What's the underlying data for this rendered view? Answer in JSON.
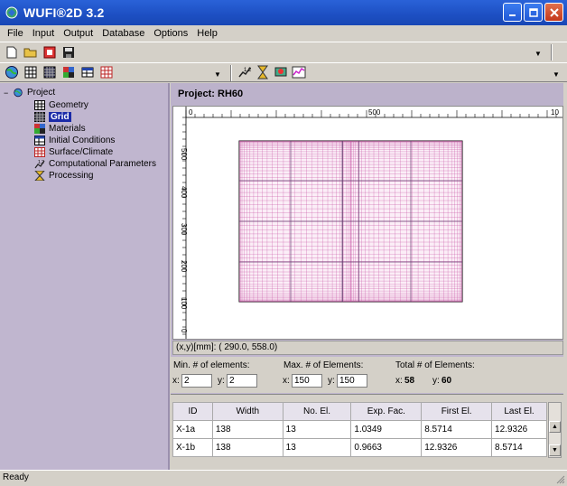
{
  "window": {
    "title": "WUFI®2D 3.2"
  },
  "menu": [
    "File",
    "Input",
    "Output",
    "Database",
    "Options",
    "Help"
  ],
  "toolbar1": {
    "icons": [
      "new-file-icon",
      "open-folder-icon",
      "export-icon",
      "save-icon"
    ]
  },
  "toolbar2": {
    "icons": [
      "globe-icon",
      "grid-icon",
      "grid-dark-icon",
      "grid-colored-icon",
      "table-icon",
      "grid-red-icon",
      "run-icon",
      "hourglass-icon",
      "results-icon",
      "chart-icon"
    ]
  },
  "tree": {
    "root": "Project",
    "items": [
      {
        "label": "Geometry",
        "icon": "geometry-icon"
      },
      {
        "label": "Grid",
        "icon": "grid-icon",
        "selected": true
      },
      {
        "label": "Materials",
        "icon": "materials-icon"
      },
      {
        "label": "Initial Conditions",
        "icon": "initial-conditions-icon"
      },
      {
        "label": "Surface/Climate",
        "icon": "surface-climate-icon"
      },
      {
        "label": "Computational Parameters",
        "icon": "computational-parameters-icon"
      },
      {
        "label": "Processing",
        "icon": "hourglass-icon"
      }
    ]
  },
  "project": {
    "header": "Project: RH60"
  },
  "ruler": {
    "x_ticks": [
      "0",
      "500",
      "10"
    ],
    "y_ticks": [
      "500",
      "400",
      "300",
      "200",
      "100",
      "0"
    ]
  },
  "coords": {
    "text": "(x,y)[mm]: ( 290.0, 558.0)"
  },
  "elements": {
    "min_label": "Min. # of elements:",
    "max_label": "Max. # of Elements:",
    "total_label": "Total # of Elements:",
    "x_prefix": "x:",
    "y_prefix": "y:",
    "min_x": "2",
    "min_y": "2",
    "max_x": "150",
    "max_y": "150",
    "total_x": "58",
    "total_y": "60"
  },
  "table": {
    "columns": [
      "ID",
      "Width",
      "No. El.",
      "Exp. Fac.",
      "First El.",
      "Last El."
    ],
    "rows": [
      [
        "X-1a",
        "138",
        "13",
        "1.0349",
        "8.5714",
        "12.9326"
      ],
      [
        "X-1b",
        "138",
        "13",
        "0.9663",
        "12.9326",
        "8.5714"
      ]
    ]
  },
  "status": {
    "text": "Ready"
  },
  "colors": {
    "title_bar": "#1d4fc2",
    "panel": "#c0b6cf",
    "selection": "#1b2aa8",
    "grid_lines": "#c44aa0"
  }
}
